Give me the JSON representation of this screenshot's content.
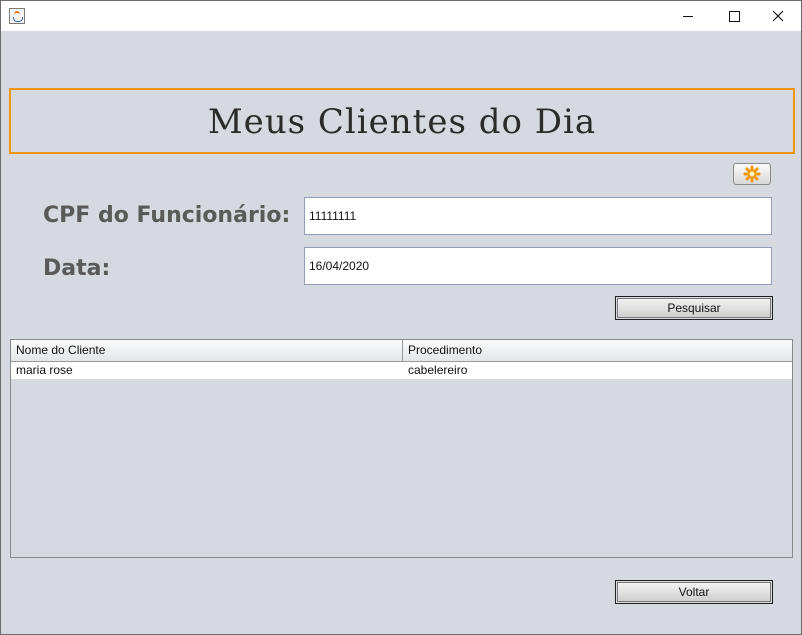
{
  "window": {
    "title": "",
    "controls": [
      "minimize",
      "maximize",
      "close"
    ]
  },
  "header": {
    "title": "Meus Clientes do Dia"
  },
  "toolbar": {
    "clear_icon": "asterisk-icon",
    "accent_color": "#f0960f"
  },
  "form": {
    "cpf_label": "CPF do Funcionário:",
    "cpf_value": "11111111",
    "date_label": "Data:",
    "date_value": "16/04/2020",
    "search_label": "Pesquisar"
  },
  "table": {
    "columns": [
      "Nome do Cliente",
      "Procedimento"
    ],
    "rows": [
      [
        "maria rose",
        "cabelereiro"
      ]
    ]
  },
  "footer": {
    "back_label": "Voltar"
  }
}
